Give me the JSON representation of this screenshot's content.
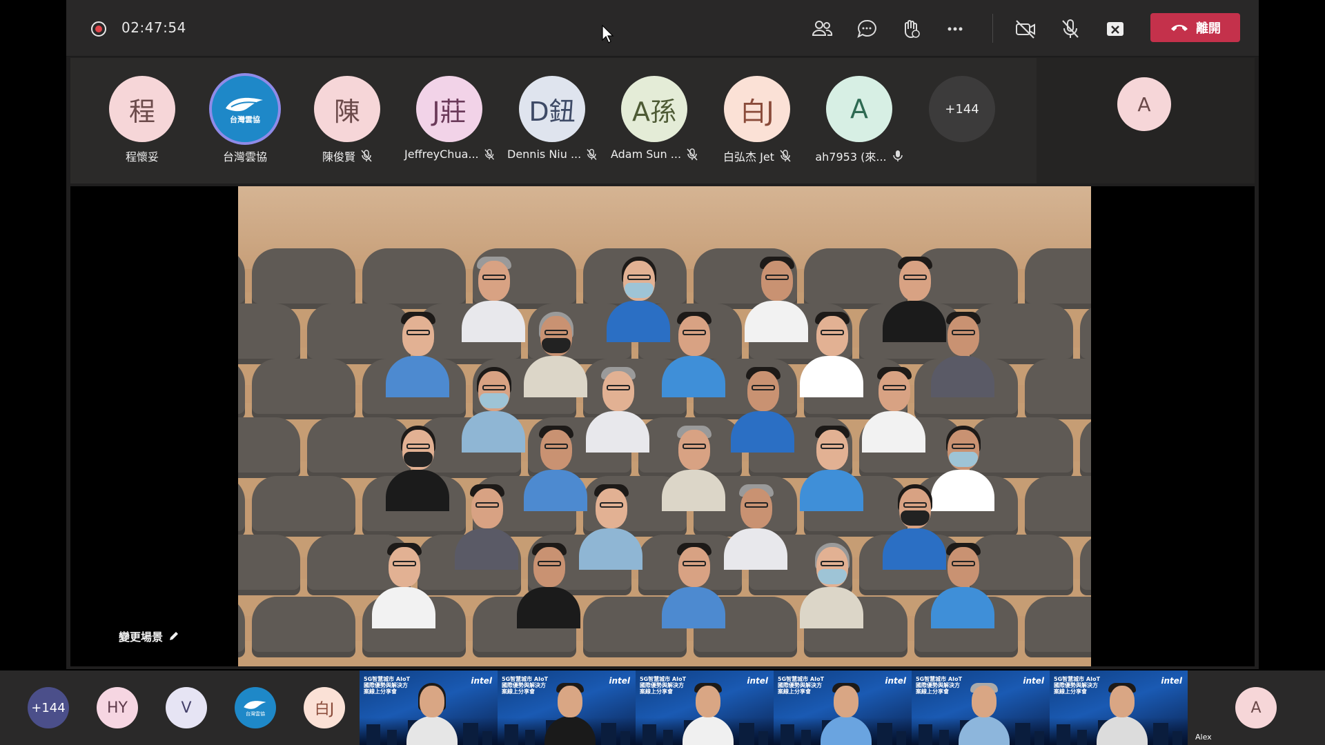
{
  "topbar": {
    "timer": "02:47:54",
    "leave_label": "離開",
    "icons": [
      "record-indicator-icon",
      "participants-icon",
      "chat-icon",
      "raise-hand-icon",
      "more-options-icon",
      "camera-off-icon",
      "mic-off-icon",
      "share-tray-icon",
      "leave-phone-icon"
    ]
  },
  "participants": [
    {
      "initials": "程",
      "name": "程懷妥",
      "muted": false,
      "avatar_bg": "#f6d6d8"
    },
    {
      "initials": "",
      "name": "台灣雲協",
      "muted": false,
      "avatar_bg": "#1e88c8",
      "logo_text": "台灣雲協"
    },
    {
      "initials": "陳",
      "name": "陳俊賢",
      "muted": true,
      "avatar_bg": "#f6d6d8"
    },
    {
      "initials": "J莊",
      "name": "JeffreyChua...",
      "muted": true,
      "avatar_bg": "#f2d3e8"
    },
    {
      "initials": "D鈕",
      "name": "Dennis Niu ...",
      "muted": true,
      "avatar_bg": "#dfe4ee"
    },
    {
      "initials": "A孫",
      "name": "Adam Sun ...",
      "muted": true,
      "avatar_bg": "#e4ecd7"
    },
    {
      "initials": "白J",
      "name": "白弘杰 Jet",
      "muted": true,
      "avatar_bg": "#fbe1d6"
    },
    {
      "initials": "A",
      "name": "ah7953 (來...",
      "muted": false,
      "avatar_bg": "#d7efe4"
    }
  ],
  "overflow_count": "+144",
  "self_avatar": "A",
  "scene": {
    "change_scene_label": "變更場景"
  },
  "bottom": {
    "overflow_count": "+144",
    "avatars": [
      {
        "initials": "HY",
        "bg": "#f6d6e2",
        "fg": "#5d3a4a"
      },
      {
        "initials": "V",
        "bg": "#e6e4f4",
        "fg": "#44406a"
      },
      {
        "initials": "",
        "bg": "#1e88c8",
        "fg": "#ffffff",
        "logo_text": "台灣雲協"
      },
      {
        "initials": "白J",
        "bg": "#fbe1d6",
        "fg": "#8a4b3a"
      }
    ],
    "thumb_title": "5G智慧城市 AIoT國際優勢與解決方案線上分享會",
    "thumb_logo": "intel",
    "self_avatar": "A",
    "self_name": "Alex"
  },
  "colors": {
    "leave": "#c4314b",
    "window": "#201f1f",
    "topbar": "#292828"
  }
}
